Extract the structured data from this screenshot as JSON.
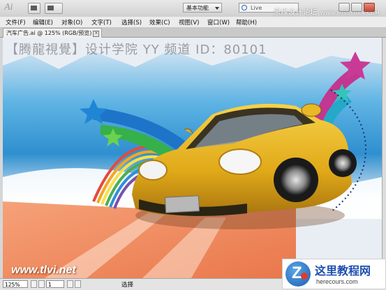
{
  "app": {
    "logo_text": "Ai",
    "workspace_label": "基本功能",
    "search_placeholder": "Live"
  },
  "watermark_top": {
    "text": "思缘设计论坛",
    "url": "WWW.MISSYUAN.COM"
  },
  "menu": [
    {
      "label": "文件(F)"
    },
    {
      "label": "编辑(E)"
    },
    {
      "label": "对象(O)"
    },
    {
      "label": "文字(T)"
    },
    {
      "label": "选择(S)"
    },
    {
      "label": "效果(C)"
    },
    {
      "label": "视图(V)"
    },
    {
      "label": "窗口(W)"
    },
    {
      "label": "帮助(H)"
    }
  ],
  "document_tab": {
    "title": "汽车广告.ai @ 125% (RGB/预览)",
    "close": "×"
  },
  "canvas": {
    "watermark_text": "【腾龍視覺】设计学院 YY 频道 ID：80101",
    "brand_url": "www.tlvi.net"
  },
  "status": {
    "zoom": "125%",
    "page": "1",
    "mode": "选择"
  },
  "badge": {
    "title": "这里教程网",
    "url": "herecours.com"
  },
  "colors": {
    "sky": "#3aa0d8",
    "car": "#e3b21c",
    "road": "#f08a5a",
    "star_magenta": "#d43d9b",
    "star_blue": "#1e8fd8"
  }
}
